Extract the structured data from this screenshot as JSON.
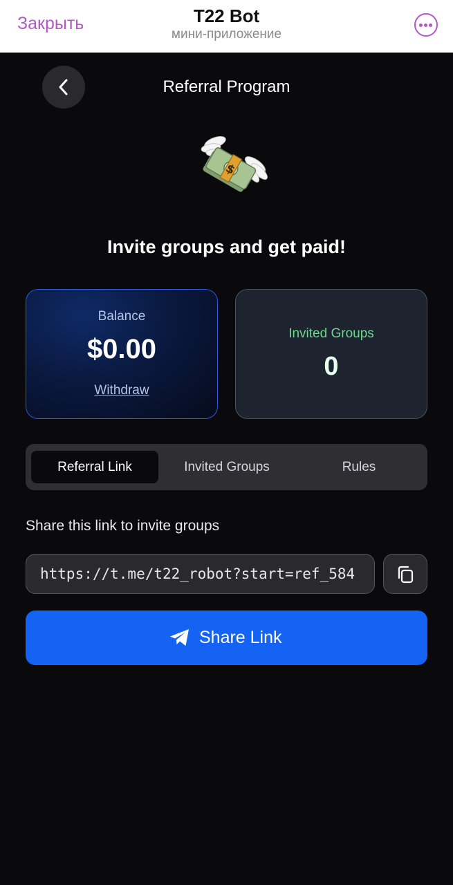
{
  "telegram_header": {
    "close_label": "Закрыть",
    "title": "T22 Bot",
    "subtitle": "мини-приложение",
    "more_icon": "ellipsis-circle-icon",
    "accent_color": "#b157c7"
  },
  "app": {
    "page_title": "Referral Program",
    "back_icon": "chevron-left-icon",
    "hero_icon": "money-with-wings-icon",
    "headline": "Invite groups and get paid!"
  },
  "balance_card": {
    "label": "Balance",
    "value": "$0.00",
    "withdraw_label": "Withdraw"
  },
  "groups_card": {
    "label": "Invited Groups",
    "value": "0"
  },
  "tabs": [
    {
      "label": "Referral Link",
      "active": true
    },
    {
      "label": "Invited Groups",
      "active": false
    },
    {
      "label": "Rules",
      "active": false
    }
  ],
  "share": {
    "label": "Share this link to invite groups",
    "link_value": "https://t.me/t22_robot?start=ref_584",
    "copy_icon": "copy-icon",
    "button_label": "Share Link",
    "button_icon": "telegram-plane-icon",
    "button_color": "#1463f3"
  }
}
